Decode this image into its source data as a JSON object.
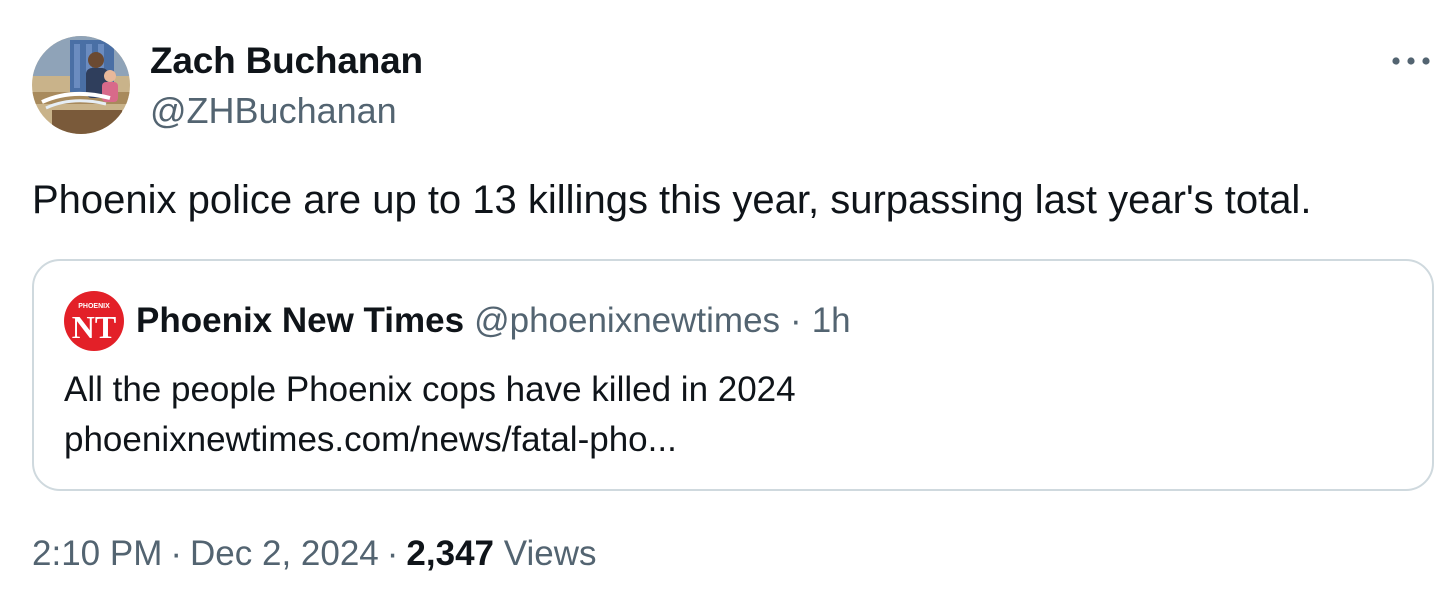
{
  "author": {
    "display_name": "Zach Buchanan",
    "handle": "@ZHBuchanan",
    "avatar_icon": "profile-photo-icon"
  },
  "more_icon": "more-dots-icon",
  "tweet": {
    "text": "Phoenix police are up to 13 killings this year, surpassing last year's total."
  },
  "quote": {
    "logo_icon": "phoenix-new-times-logo-icon",
    "logo_text": "NT",
    "logo_subtext": "PHOENIX",
    "logo_color": "#e32028",
    "name": "Phoenix New Times",
    "handle": "@phoenixnewtimes",
    "separator": "·",
    "time": "1h",
    "text_line1": "All the people Phoenix cops have killed in 2024",
    "text_line2": "phoenixnewtimes.com/news/fatal-pho..."
  },
  "meta": {
    "time": "2:10 PM",
    "separator": "·",
    "date": "Dec 2, 2024",
    "views_count": "2,347",
    "views_label": "Views"
  },
  "colors": {
    "text_primary": "#0f1419",
    "text_secondary": "#536471",
    "border": "#cfd9de"
  }
}
